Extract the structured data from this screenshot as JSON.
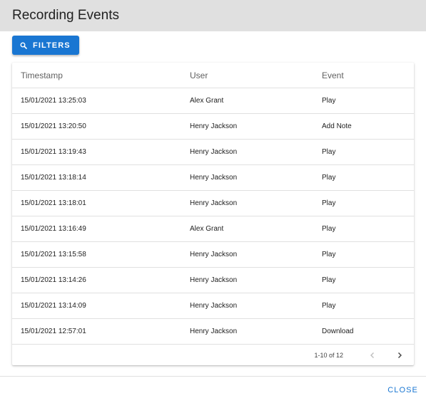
{
  "dialog": {
    "title": "Recording Events"
  },
  "toolbar": {
    "filters_label": "FILTERS",
    "filters_icon": "search-icon"
  },
  "table": {
    "columns": [
      "Timestamp",
      "User",
      "Event"
    ],
    "rows": [
      {
        "timestamp": "15/01/2021 13:25:03",
        "user": "Alex Grant",
        "event": "Play"
      },
      {
        "timestamp": "15/01/2021 13:20:50",
        "user": "Henry Jackson",
        "event": "Add Note"
      },
      {
        "timestamp": "15/01/2021 13:19:43",
        "user": "Henry Jackson",
        "event": "Play"
      },
      {
        "timestamp": "15/01/2021 13:18:14",
        "user": "Henry Jackson",
        "event": "Play"
      },
      {
        "timestamp": "15/01/2021 13:18:01",
        "user": "Henry Jackson",
        "event": "Play"
      },
      {
        "timestamp": "15/01/2021 13:16:49",
        "user": "Alex Grant",
        "event": "Play"
      },
      {
        "timestamp": "15/01/2021 13:15:58",
        "user": "Henry Jackson",
        "event": "Play"
      },
      {
        "timestamp": "15/01/2021 13:14:26",
        "user": "Henry Jackson",
        "event": "Play"
      },
      {
        "timestamp": "15/01/2021 13:14:09",
        "user": "Henry Jackson",
        "event": "Play"
      },
      {
        "timestamp": "15/01/2021 12:57:01",
        "user": "Henry Jackson",
        "event": "Download"
      }
    ]
  },
  "pagination": {
    "range": "1-10 of 12",
    "prev_icon": "chevron-left-icon",
    "next_icon": "chevron-right-icon"
  },
  "footer": {
    "close_label": "CLOSE"
  },
  "colors": {
    "header_bg": "#e0e0e0",
    "primary": "#1976d2"
  }
}
